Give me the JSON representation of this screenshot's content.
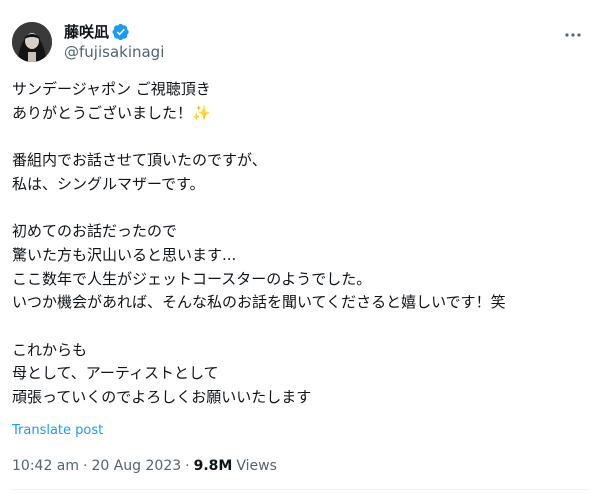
{
  "user": {
    "display_name": "藤咲凪",
    "handle": "@fujisakinagi"
  },
  "tweet": {
    "text": "サンデージャポン ご視聴頂き\nありがとうございました！✨\n\n番組内でお話させて頂いたのですが、\n私は、シングルマザーです。\n\n初めてのお話だったので\n驚いた方も沢山いると思います...\nここ数年で人生がジェットコースターのようでした。\nいつか機会があれば、そんな私のお話を聞いてくださると嬉しいです！笑\n\nこれからも\n母として、アーティストとして\n頑張っていくのでよろしくお願いいたします",
    "translate_label": "Translate post",
    "time": "10:42 am",
    "separator": "·",
    "date": "20 Aug 2023",
    "views_count": "9.8M",
    "views_label": "Views"
  },
  "icons": {
    "verified": "verified-badge-icon",
    "more": "more-options-icon"
  },
  "colors": {
    "link": "#1d9bf0",
    "secondary_text": "#536471",
    "primary_text": "#0f1419"
  }
}
